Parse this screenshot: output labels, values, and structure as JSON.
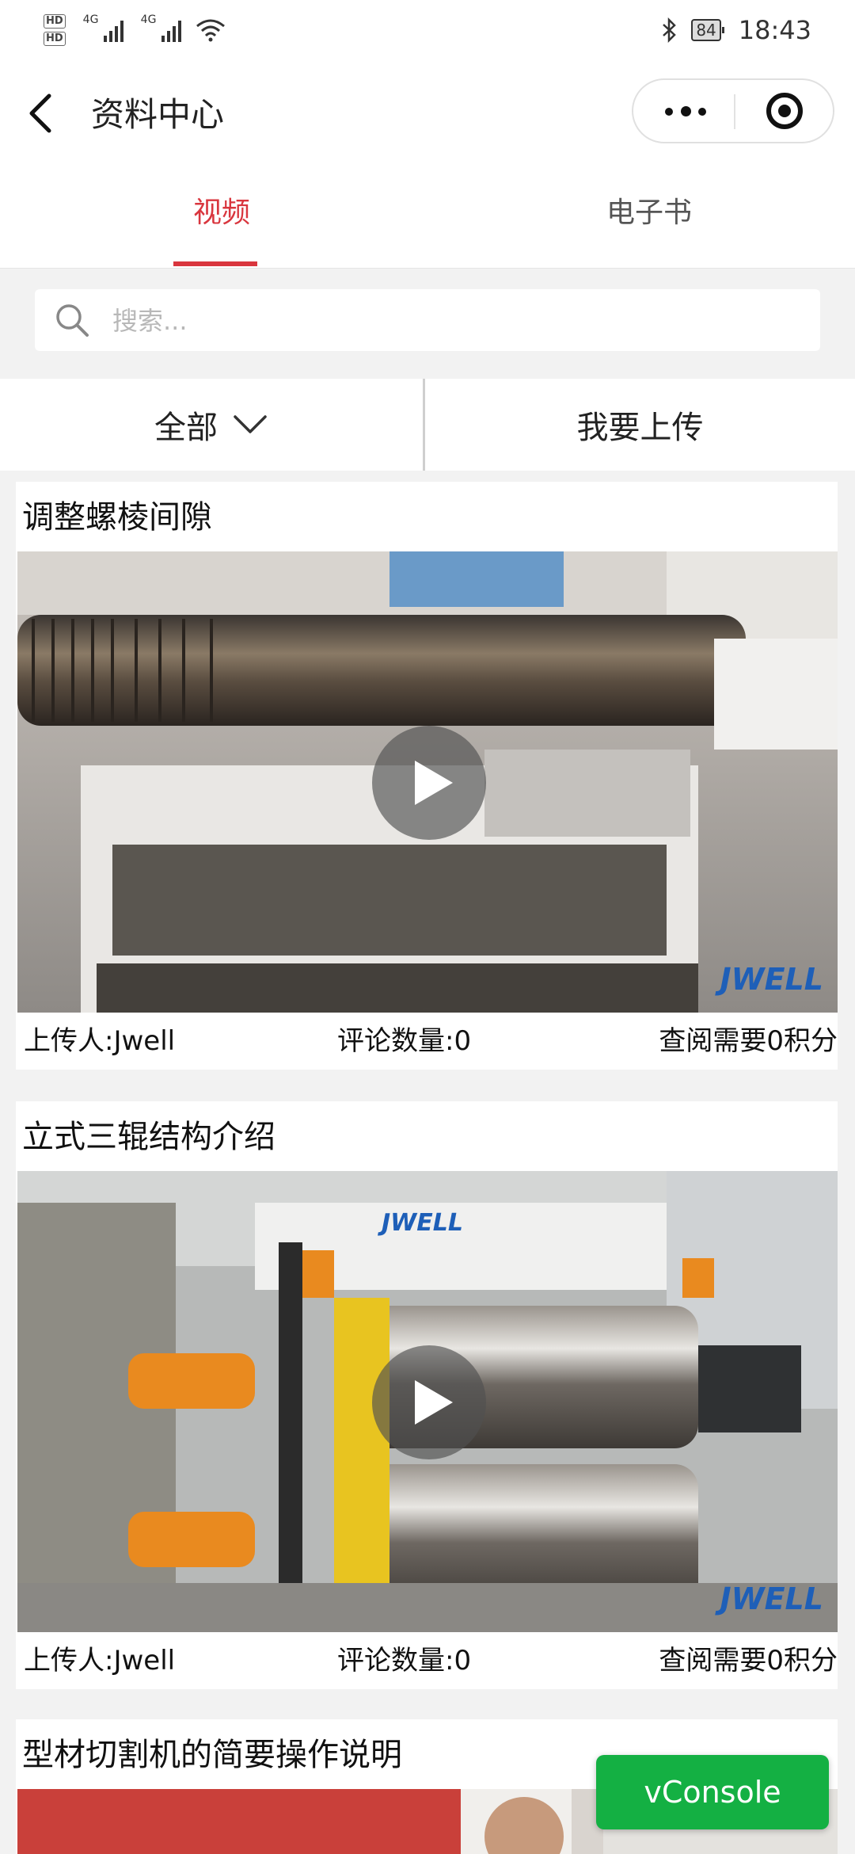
{
  "status_bar": {
    "network_badges": [
      "HD",
      "HD"
    ],
    "network_labels": [
      "4G",
      "4G"
    ],
    "battery": "84",
    "time": "18:43"
  },
  "header": {
    "title": "资料中心",
    "back_icon": "chevron-left-icon",
    "more_icon": "more-dots-icon",
    "close_icon": "target-circle-icon"
  },
  "tabs": [
    {
      "label": "视频",
      "active": true
    },
    {
      "label": "电子书",
      "active": false
    }
  ],
  "colors": {
    "accent": "#d9363e",
    "vconsole": "#14b043",
    "brand": "#1e5fb8"
  },
  "search": {
    "placeholder": "搜索..."
  },
  "filter": {
    "category_label": "全部",
    "upload_label": "我要上传"
  },
  "videos": [
    {
      "title": "调整螺棱间隙",
      "uploader": "上传人:Jwell",
      "comments": "评论数量:0",
      "cost": "查阅需要0积分",
      "watermark": "JWELL"
    },
    {
      "title": "立式三辊结构介绍",
      "uploader": "上传人:Jwell",
      "comments": "评论数量:0",
      "cost": "查阅需要0积分",
      "watermark": "JWELL"
    },
    {
      "title": "型材切割机的简要操作说明"
    }
  ],
  "vconsole": {
    "label": "vConsole"
  }
}
